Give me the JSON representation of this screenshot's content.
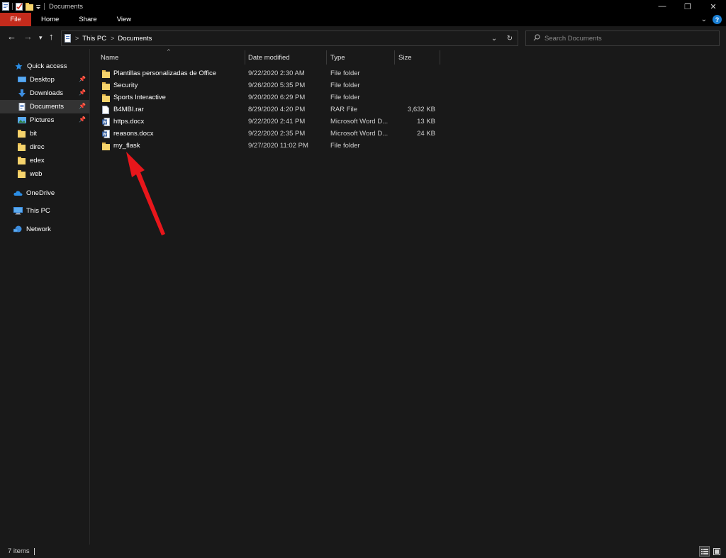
{
  "window": {
    "title": "Documents",
    "controls": {
      "minimize": "—",
      "restore": "❐",
      "close": "✕"
    }
  },
  "ribbon": {
    "tabs": [
      "File",
      "Home",
      "Share",
      "View"
    ],
    "help_label": "?"
  },
  "nav": {
    "back": "←",
    "forward": "→",
    "recent": "▾",
    "up": "↑",
    "breadcrumb": [
      "This PC",
      "Documents"
    ],
    "refresh": "↻",
    "dropdown": "⌄"
  },
  "search": {
    "placeholder": "Search Documents"
  },
  "sidebar": {
    "quick_access": "Quick access",
    "items": [
      {
        "label": "Desktop",
        "icon": "desktop-icon",
        "pinned": true
      },
      {
        "label": "Downloads",
        "icon": "download-icon",
        "pinned": true
      },
      {
        "label": "Documents",
        "icon": "documents-icon",
        "pinned": true,
        "selected": true
      },
      {
        "label": "Pictures",
        "icon": "pictures-icon",
        "pinned": true
      },
      {
        "label": "bit",
        "icon": "folder-icon"
      },
      {
        "label": "direc",
        "icon": "folder-icon"
      },
      {
        "label": "edex",
        "icon": "folder-icon"
      },
      {
        "label": "web",
        "icon": "folder-icon"
      }
    ],
    "onedrive": "OneDrive",
    "this_pc": "This PC",
    "network": "Network"
  },
  "columns": {
    "name": "Name",
    "date": "Date modified",
    "type": "Type",
    "size": "Size"
  },
  "files": [
    {
      "name": "Plantillas personalizadas de Office",
      "date": "9/22/2020 2:30 AM",
      "type": "File folder",
      "size": "",
      "icon": "folder-icon"
    },
    {
      "name": "Security",
      "date": "9/26/2020 5:35 PM",
      "type": "File folder",
      "size": "",
      "icon": "folder-icon"
    },
    {
      "name": "Sports Interactive",
      "date": "9/20/2020 6:29 PM",
      "type": "File folder",
      "size": "",
      "icon": "folder-icon"
    },
    {
      "name": "B4MBI.rar",
      "date": "8/29/2020 4:20 PM",
      "type": "RAR File",
      "size": "3,632 KB",
      "icon": "file-icon"
    },
    {
      "name": "https.docx",
      "date": "9/22/2020 2:41 PM",
      "type": "Microsoft Word D...",
      "size": "13 KB",
      "icon": "word-doc-icon"
    },
    {
      "name": "reasons.docx",
      "date": "9/22/2020 2:35 PM",
      "type": "Microsoft Word D...",
      "size": "24 KB",
      "icon": "word-doc-icon"
    },
    {
      "name": "my_flask",
      "date": "9/27/2020 11:02 PM",
      "type": "File folder",
      "size": "",
      "icon": "folder-icon"
    }
  ],
  "status": {
    "item_count": "7 items"
  },
  "colors": {
    "file_tab": "#c42b1c",
    "folder": "#f5d36c",
    "annotation_arrow": "#e8161b",
    "accent_blue": "#1a7fd4"
  }
}
